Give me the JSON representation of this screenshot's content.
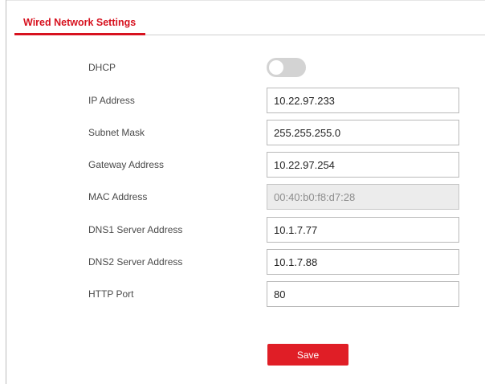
{
  "tab": {
    "label": "Wired Network Settings"
  },
  "dhcp": {
    "label": "DHCP",
    "enabled": false
  },
  "ip_address": {
    "label": "IP Address",
    "value": "10.22.97.233"
  },
  "subnet_mask": {
    "label": "Subnet Mask",
    "value": "255.255.255.0"
  },
  "gateway_address": {
    "label": "Gateway Address",
    "value": "10.22.97.254"
  },
  "mac_address": {
    "label": "MAC Address",
    "value": "00:40:b0:f8:d7:28"
  },
  "dns1": {
    "label": "DNS1 Server Address",
    "value": "10.1.7.77"
  },
  "dns2": {
    "label": "DNS2 Server Address",
    "value": "10.1.7.88"
  },
  "http_port": {
    "label": "HTTP Port",
    "value": "80"
  },
  "save_button": {
    "label": "Save"
  },
  "colors": {
    "accent": "#e01e26",
    "toggle_off": "#d3d3d3",
    "disabled_field": "#ececec"
  }
}
